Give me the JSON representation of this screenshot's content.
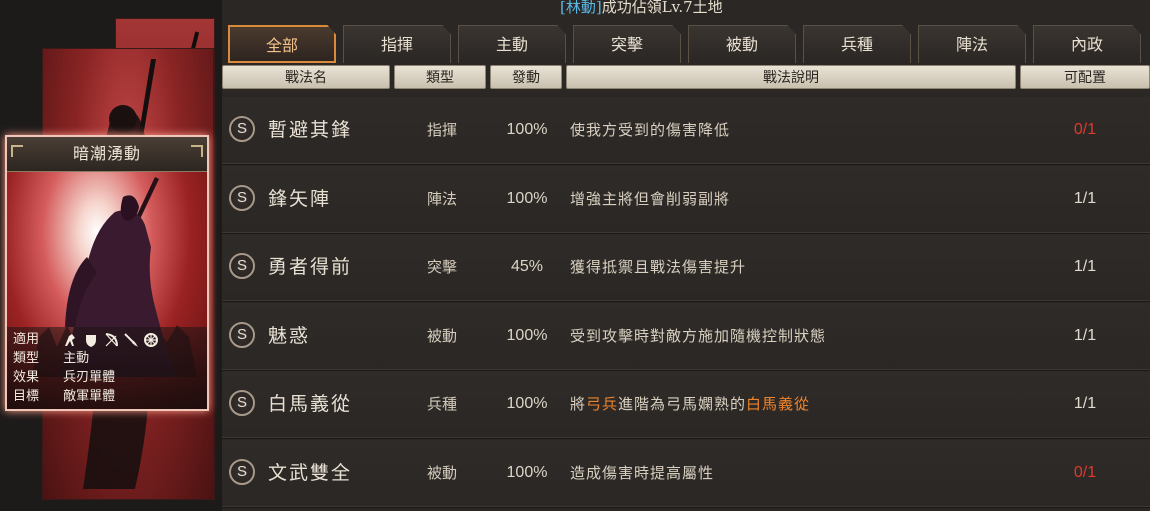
{
  "notice": {
    "tag": "[林動]",
    "text": "成功佔領Lv.7土地"
  },
  "tabs": [
    {
      "label": "全部",
      "active": true
    },
    {
      "label": "指揮",
      "active": false
    },
    {
      "label": "主動",
      "active": false
    },
    {
      "label": "突擊",
      "active": false
    },
    {
      "label": "被動",
      "active": false
    },
    {
      "label": "兵種",
      "active": false
    },
    {
      "label": "陣法",
      "active": false
    },
    {
      "label": "內政",
      "active": false
    }
  ],
  "columns": {
    "name": "戰法名",
    "type": "類型",
    "rate": "發動",
    "desc": "戰法說明",
    "slot": "可配置"
  },
  "card": {
    "title": "暗潮湧動",
    "applicable_label": "適用",
    "applicable_icons": [
      "cavalry-icon",
      "shield-icon",
      "bow-icon",
      "spear-icon",
      "wheel-icon"
    ],
    "type_label": "類型",
    "type_value": "主動",
    "effect_label": "效果",
    "effect_value": "兵刃單體",
    "target_label": "目標",
    "target_value": "敵軍單體",
    "frame_color": "#f0c6b8",
    "glow_color": "#c94b4b"
  },
  "tactics": [
    {
      "badge": "S",
      "name": "暫避其鋒",
      "type": "指揮",
      "rate": "100%",
      "desc": "使我方受到的傷害降低",
      "desc_parts": [],
      "slot": "0/1",
      "slot_full": true
    },
    {
      "badge": "S",
      "name": "鋒矢陣",
      "type": "陣法",
      "rate": "100%",
      "desc": "增強主將但會削弱副將",
      "desc_parts": [],
      "slot": "1/1",
      "slot_full": false
    },
    {
      "badge": "S",
      "name": "勇者得前",
      "type": "突擊",
      "rate": "45%",
      "desc": "獲得抵禦且戰法傷害提升",
      "desc_parts": [],
      "slot": "1/1",
      "slot_full": false
    },
    {
      "badge": "S",
      "name": "魅惑",
      "type": "被動",
      "rate": "100%",
      "desc": "受到攻擊時對敵方施加隨機控制狀態",
      "desc_parts": [],
      "slot": "1/1",
      "slot_full": false
    },
    {
      "badge": "S",
      "name": "白馬義從",
      "type": "兵種",
      "rate": "100%",
      "desc": "",
      "desc_parts": [
        {
          "text": "將",
          "hl": false
        },
        {
          "text": "弓兵",
          "hl": true
        },
        {
          "text": "進階為弓馬嫻熟的",
          "hl": false
        },
        {
          "text": "白馬義從",
          "hl": true
        }
      ],
      "slot": "1/1",
      "slot_full": false
    },
    {
      "badge": "S",
      "name": "文武雙全",
      "type": "被動",
      "rate": "100%",
      "desc": "造成傷害時提高屬性",
      "desc_parts": [],
      "slot": "0/1",
      "slot_full": true
    }
  ],
  "colors": {
    "accent": "#d98a3a",
    "highlight": "#f0842a",
    "limit_red": "#e03a2a",
    "notice_tag": "#5ab8e6"
  }
}
